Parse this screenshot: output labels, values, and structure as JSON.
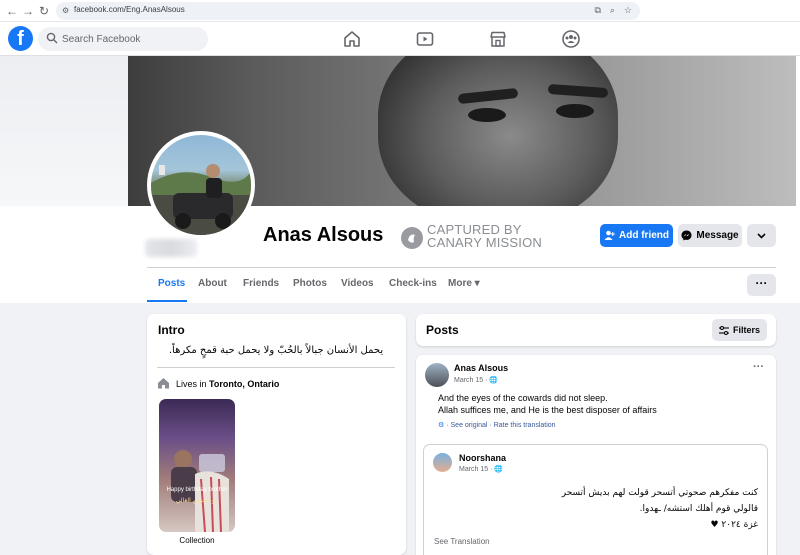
{
  "browser": {
    "url": "facebook.com/Eng.AnasAlsous",
    "back_icon": "back-arrow-icon",
    "forward_icon": "forward-arrow-icon",
    "reload_icon": "reload-icon"
  },
  "header": {
    "logo_letter": "f",
    "search_placeholder": "Search Facebook",
    "nav_icons": [
      "home-icon",
      "video-icon",
      "marketplace-icon",
      "groups-icon"
    ]
  },
  "profile": {
    "name": "Anas Alsous",
    "stamp_line1": "CAPTURED BY",
    "stamp_line2": "CANARY MISSION",
    "add_friend_label": "Add friend",
    "message_label": "Message",
    "more_dots": "···"
  },
  "tabs": [
    {
      "label": "Posts",
      "active": true
    },
    {
      "label": "About",
      "active": false
    },
    {
      "label": "Friends",
      "active": false
    },
    {
      "label": "Photos",
      "active": false
    },
    {
      "label": "Videos",
      "active": false
    },
    {
      "label": "Check-ins",
      "active": false
    },
    {
      "label": "More ▾",
      "active": false
    }
  ],
  "intro": {
    "title": "Intro",
    "bio": "يحمل الأنسان جبالاً بالحُبّ ولا يحمل حبة قمحٍ مكرهاً.",
    "lives_prefix": "Lives in ",
    "lives_city": "Toronto, Ontario",
    "collection_caption1": "Happy birthday brother",
    "collection_caption2": "أبو الحسن الغالي",
    "collection_label": "Collection"
  },
  "posts": {
    "title": "Posts",
    "filters_label": "Filters",
    "post": {
      "author": "Anas Alsous",
      "date": "March 15 · 🌐",
      "line1": "And the eyes of the cowards did not sleep.",
      "line2": "Allah suffices me, and He is the best disposer of affairs",
      "see_original": "· See original · Rate this translation",
      "menu": "···"
    },
    "shared": {
      "author": "Noorshana",
      "date": "March 15 · 🌐",
      "line1": "كنت مفكرهم صحوتي أتسحر قولت لهم بديش أتسحر",
      "line2": "قالولي قوم أهلك استشه/ ـهدوا.",
      "line3": "غزة ٢٠٢٤ ♥",
      "see_translation": "See Translation"
    }
  },
  "colors": {
    "brand": "#1877f2",
    "background": "#f0f2f5",
    "secondary_button": "#e4e6eb"
  }
}
